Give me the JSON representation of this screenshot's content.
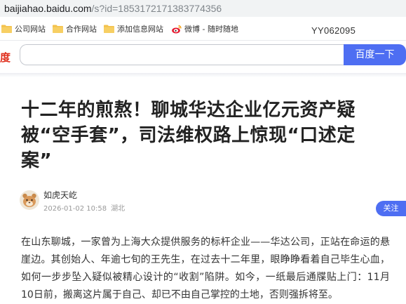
{
  "browser": {
    "url_host": "baijiahao.baidu.com",
    "url_path": "/s?id=1853172171383774356"
  },
  "bookmarks": {
    "items": [
      {
        "label": "公司网站",
        "icon": "folder-icon"
      },
      {
        "label": "合作网站",
        "icon": "folder-icon"
      },
      {
        "label": "添加信息网站",
        "icon": "folder-icon"
      },
      {
        "label": "微博 - 随时随地",
        "icon": "weibo-icon"
      }
    ],
    "code_text": "YY062095"
  },
  "search": {
    "logo_fragment": "度",
    "input_value": "",
    "button_label": "百度一下"
  },
  "article": {
    "title": "十二年的煎熬！聊城华达企业亿元资产疑被“空手套”，司法维权路上惊现“口述定案”",
    "author_name": "如虎天屹",
    "timestamp": "2026-01-02 10:58",
    "location": "湖北",
    "follow_label": "关注",
    "body": "在山东聊城，一家曾为上海大众提供服务的标杆企业——华达公司，正站在命运的悬崖边。其创始人、年逾七旬的王先生，在过去十二年里，眼睁睁看着自己毕生心血，如何一步步坠入疑似被精心设计的“收割”陷阱。如今，一纸最后通牒贴上门：11月10日前，搬离这片属于自己、却已不由自己掌控的土地，否则强拆将至。"
  },
  "colors": {
    "accent": "#4e6ef2",
    "logo_red": "#e0301e",
    "folder": "#f3c24d",
    "weibo": "#e6162d"
  }
}
